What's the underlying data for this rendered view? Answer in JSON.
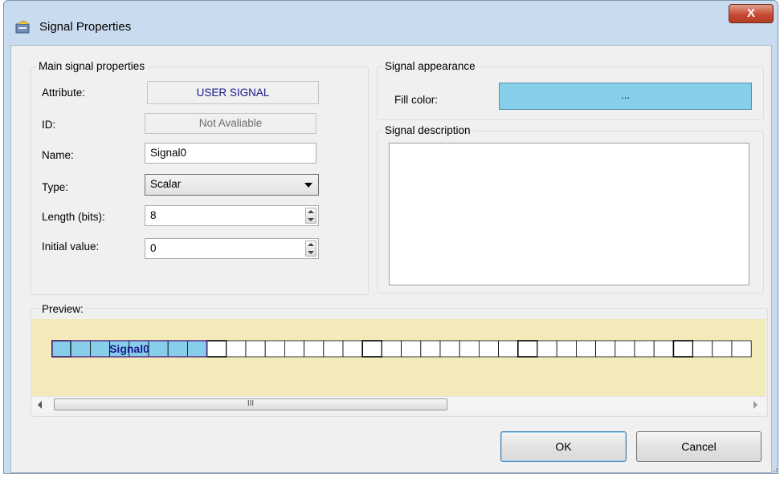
{
  "window": {
    "title": "Signal Properties",
    "close_label": "X"
  },
  "main_group": {
    "label": "Main signal properties",
    "attribute_label": "Attribute:",
    "attribute_value": "USER SIGNAL",
    "id_label": "ID:",
    "id_value": "Not Avaliable",
    "name_label": "Name:",
    "name_value": "Signal0",
    "type_label": "Type:",
    "type_value": "Scalar",
    "length_label": "Length (bits):",
    "length_value": "8",
    "initial_label": "Initial value:",
    "initial_value": "0"
  },
  "appearance_group": {
    "label": "Signal appearance",
    "fill_label": "Fill color:",
    "fill_button": "...",
    "fill_color": "#87ceeb"
  },
  "description_group": {
    "label": "Signal description",
    "value": ""
  },
  "preview": {
    "label": "Preview:",
    "signal_name": "Signal0",
    "signal_bits": 8,
    "scroll_thumb_glyph": "III"
  },
  "buttons": {
    "ok": "OK",
    "cancel": "Cancel"
  },
  "icons": {
    "title": "signal-properties-icon",
    "close": "close-icon",
    "combo": "chevron-down-icon"
  },
  "colors": {
    "preview_bg": "#f2eab8",
    "signal_fill": "#87ceeb",
    "signal_text": "#1a1a8c"
  }
}
